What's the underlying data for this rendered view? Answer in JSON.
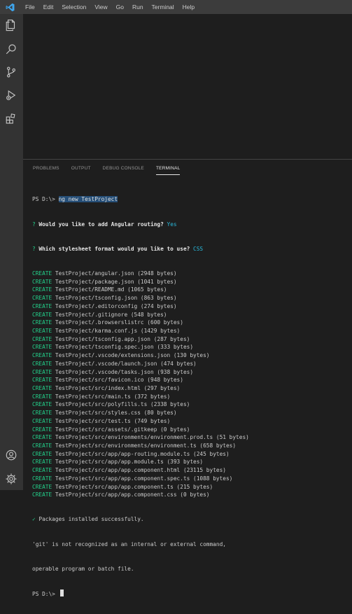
{
  "menu": [
    "File",
    "Edit",
    "Selection",
    "View",
    "Go",
    "Run",
    "Terminal",
    "Help"
  ],
  "activity_icons": [
    "explorer-icon",
    "search-icon",
    "source-control-icon",
    "run-debug-icon",
    "extensions-icon"
  ],
  "activity_bottom_icons": [
    "account-icon",
    "manage-gear-icon"
  ],
  "panel": {
    "tabs": [
      "PROBLEMS",
      "OUTPUT",
      "DEBUG CONSOLE",
      "TERMINAL"
    ],
    "active_tab": "TERMINAL"
  },
  "terminal": {
    "prompt": "PS D:\\>",
    "command": "ng new TestProject",
    "q1_mark": "?",
    "q1_text": "Would you like to add Angular routing?",
    "q1_answer": "Yes",
    "q2_mark": "?",
    "q2_text": "Which stylesheet format would you like to use?",
    "q2_answer": "CSS",
    "create_label": "CREATE",
    "created_files": [
      "TestProject/angular.json (2948 bytes)",
      "TestProject/package.json (1041 bytes)",
      "TestProject/README.md (1065 bytes)",
      "TestProject/tsconfig.json (863 bytes)",
      "TestProject/.editorconfig (274 bytes)",
      "TestProject/.gitignore (548 bytes)",
      "TestProject/.browserslistrc (600 bytes)",
      "TestProject/karma.conf.js (1429 bytes)",
      "TestProject/tsconfig.app.json (287 bytes)",
      "TestProject/tsconfig.spec.json (333 bytes)",
      "TestProject/.vscode/extensions.json (130 bytes)",
      "TestProject/.vscode/launch.json (474 bytes)",
      "TestProject/.vscode/tasks.json (938 bytes)",
      "TestProject/src/favicon.ico (948 bytes)",
      "TestProject/src/index.html (297 bytes)",
      "TestProject/src/main.ts (372 bytes)",
      "TestProject/src/polyfills.ts (2338 bytes)",
      "TestProject/src/styles.css (80 bytes)",
      "TestProject/src/test.ts (749 bytes)",
      "TestProject/src/assets/.gitkeep (0 bytes)",
      "TestProject/src/environments/environment.prod.ts (51 bytes)",
      "TestProject/src/environments/environment.ts (658 bytes)",
      "TestProject/src/app/app-routing.module.ts (245 bytes)",
      "TestProject/src/app/app.module.ts (393 bytes)",
      "TestProject/src/app/app.component.html (23115 bytes)",
      "TestProject/src/app/app.component.spec.ts (1088 bytes)",
      "TestProject/src/app/app.component.ts (215 bytes)",
      "TestProject/src/app/app.component.css (0 bytes)"
    ],
    "success_mark": "✓",
    "success_text": "Packages installed successfully.",
    "error_line1": "'git' is not recognized as an internal or external command,",
    "error_line2": "operable program or batch file.",
    "final_prompt": "PS D:\\>"
  }
}
